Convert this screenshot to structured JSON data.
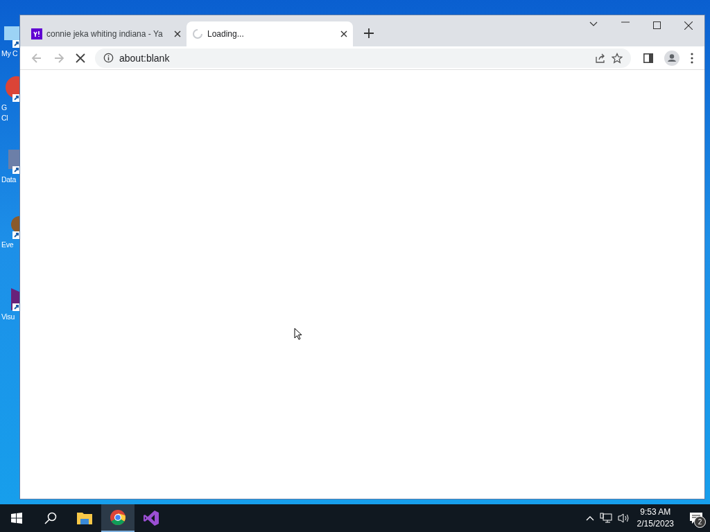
{
  "desktop_icons": [
    {
      "kind": "computer",
      "lines": [
        "My C"
      ]
    },
    {
      "kind": "chrome",
      "lines": [
        "G",
        "Cl"
      ]
    },
    {
      "kind": "data",
      "lines": [
        "Data"
      ]
    },
    {
      "kind": "event",
      "lines": [
        "Eve"
      ]
    },
    {
      "kind": "studio",
      "lines": [
        "Visu"
      ]
    }
  ],
  "browser": {
    "tabs": [
      {
        "kind": "page",
        "title": "connie jeka whiting indiana - Ya",
        "selected": false
      },
      {
        "kind": "loading",
        "title": "Loading...",
        "selected": true
      }
    ],
    "loading": true,
    "address": "about:blank"
  },
  "taskbar": {
    "apps": [
      {
        "kind": "explorer",
        "selected": false
      },
      {
        "kind": "chrome",
        "selected": true
      },
      {
        "kind": "studio",
        "selected": false
      }
    ],
    "time": "9:53 AM",
    "date": "2/15/2023",
    "notifications": "2"
  }
}
